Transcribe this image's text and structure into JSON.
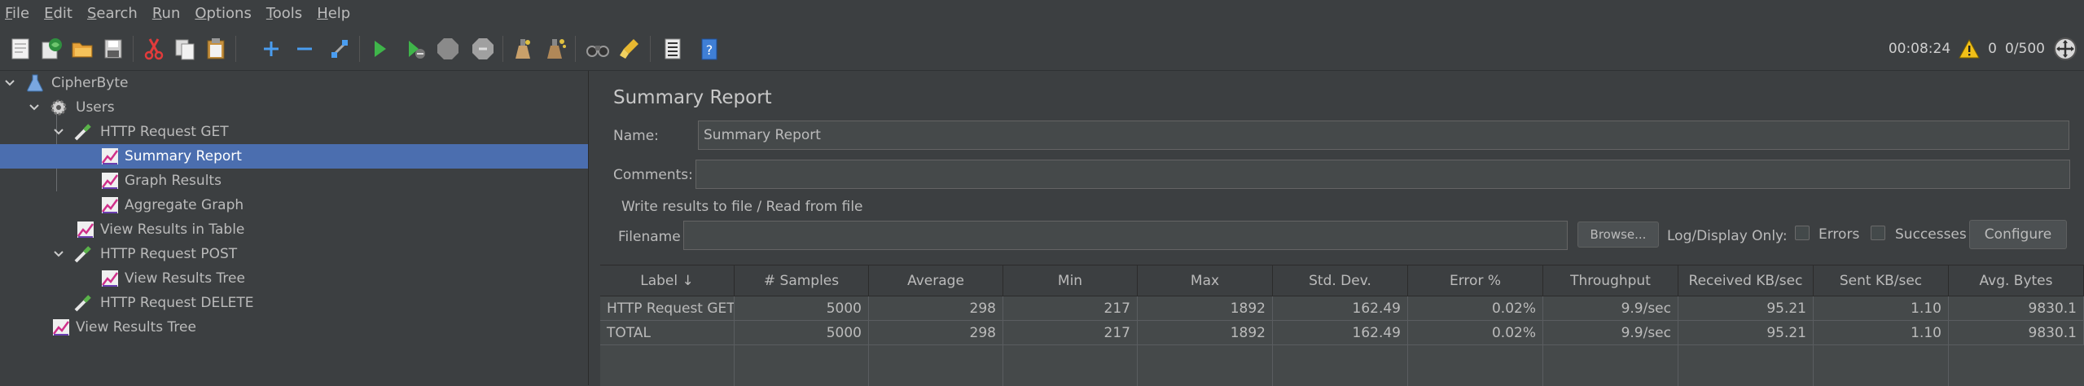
{
  "menu": [
    {
      "mn": "F",
      "rest": "ile"
    },
    {
      "mn": "E",
      "rest": "dit"
    },
    {
      "mn": "S",
      "rest": "earch"
    },
    {
      "mn": "R",
      "rest": "un"
    },
    {
      "mn": "O",
      "rest": "ptions"
    },
    {
      "mn": "T",
      "rest": "ools"
    },
    {
      "mn": "H",
      "rest": "elp"
    }
  ],
  "status": {
    "elapsed": "00:08:24",
    "warnings": "0",
    "threads": "0/500"
  },
  "tree": [
    {
      "label": "CipherByte"
    },
    {
      "label": "Users"
    },
    {
      "label": "HTTP Request GET"
    },
    {
      "label": "Summary Report"
    },
    {
      "label": "Graph Results"
    },
    {
      "label": "Aggregate Graph"
    },
    {
      "label": "View Results in Table"
    },
    {
      "label": "HTTP Request POST"
    },
    {
      "label": "View Results Tree"
    },
    {
      "label": "HTTP Request DELETE"
    },
    {
      "label": "View Results Tree"
    }
  ],
  "panel": {
    "title": "Summary Report",
    "name_label": "Name:",
    "name_value": "Summary Report",
    "comments_label": "Comments:",
    "comments_value": "",
    "file_section": "Write results to file / Read from file",
    "filename_label": "Filename",
    "filename_value": "",
    "browse": "Browse...",
    "log_display": "Log/Display Only:",
    "errors": "Errors",
    "successes": "Successes",
    "configure": "Configure"
  },
  "table": {
    "headers": [
      "Label ↓",
      "# Samples",
      "Average",
      "Min",
      "Max",
      "Std. Dev.",
      "Error %",
      "Throughput",
      "Received KB/sec",
      "Sent KB/sec",
      "Avg. Bytes"
    ],
    "rows": [
      [
        "HTTP Request GET",
        "5000",
        "298",
        "217",
        "1892",
        "162.49",
        "0.02%",
        "9.9/sec",
        "95.21",
        "1.10",
        "9830.1"
      ],
      [
        "TOTAL",
        "5000",
        "298",
        "217",
        "1892",
        "162.49",
        "0.02%",
        "9.9/sec",
        "95.21",
        "1.10",
        "9830.1"
      ]
    ]
  }
}
